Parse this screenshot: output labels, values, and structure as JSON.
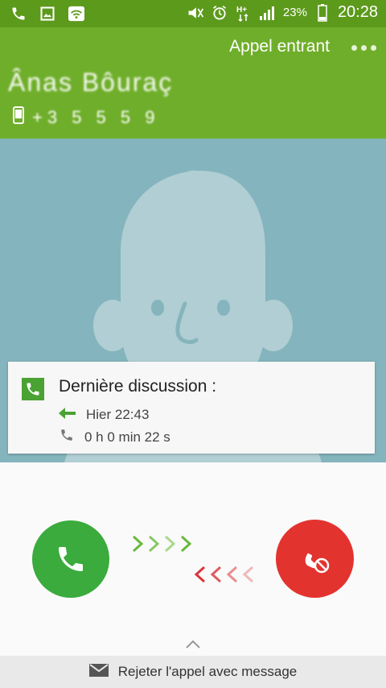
{
  "status_bar": {
    "icons_left": [
      "phone-icon",
      "image-icon",
      "wifi-icon"
    ],
    "icons_right": [
      "mute-icon",
      "alarm-icon",
      "network-h-plus-icon",
      "signal-icon"
    ],
    "battery": "23%",
    "time": "20:28"
  },
  "header": {
    "call_status": "Appel entrant",
    "caller_name": "Ânas Bôuraç",
    "phone_number": "+3 5 5 5 9"
  },
  "last_call": {
    "title": "Dernière discussion :",
    "when": "Hier 22:43",
    "duration": "0 h 0 min 22 s"
  },
  "actions": {
    "reject_with_message": "Rejeter l'appel avec message"
  },
  "colors": {
    "status_bar": "#5c9a1c",
    "header": "#6fae2a",
    "accept": "#3aab3c",
    "reject": "#e3332f",
    "photo_bg": "#84b4bd"
  }
}
